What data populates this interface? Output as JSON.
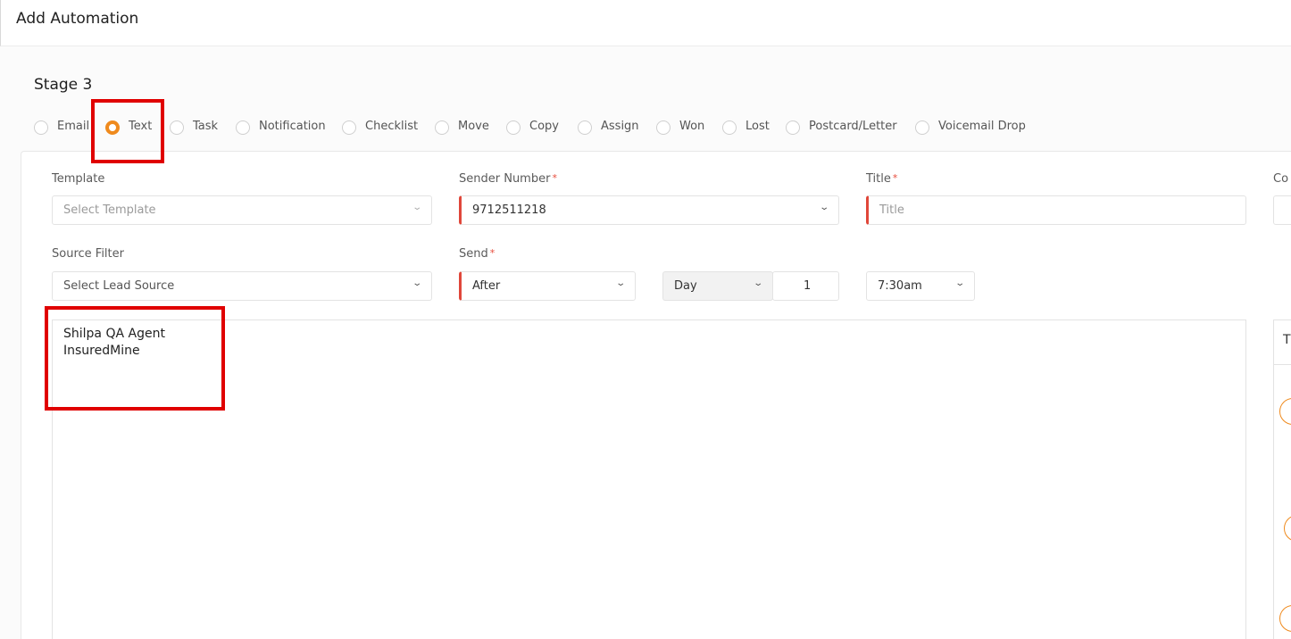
{
  "header": {
    "title": "Add Automation"
  },
  "stage": {
    "title": "Stage 3"
  },
  "action_types": [
    {
      "label": "Email",
      "checked": false
    },
    {
      "label": "Text",
      "checked": true
    },
    {
      "label": "Task",
      "checked": false
    },
    {
      "label": "Notification",
      "checked": false
    },
    {
      "label": "Checklist",
      "checked": false
    },
    {
      "label": "Move",
      "checked": false
    },
    {
      "label": "Copy",
      "checked": false
    },
    {
      "label": "Assign",
      "checked": false
    },
    {
      "label": "Won",
      "checked": false
    },
    {
      "label": "Lost",
      "checked": false
    },
    {
      "label": "Postcard/Letter",
      "checked": false
    },
    {
      "label": "Voicemail Drop",
      "checked": false
    }
  ],
  "form": {
    "template": {
      "label": "Template",
      "placeholder": "Select Template"
    },
    "sender_number": {
      "label": "Sender Number",
      "required_mark": "*",
      "value": "9712511218"
    },
    "title": {
      "label": "Title",
      "required_mark": "*",
      "placeholder": "Title"
    },
    "cut_label": "Co",
    "source_filter": {
      "label": "Source Filter",
      "placeholder": "Select Lead Source"
    },
    "send": {
      "label": "Send",
      "required_mark": "*",
      "timing": "After",
      "unit": "Day",
      "amount": "1",
      "time": "7:30am"
    }
  },
  "editor": {
    "lines": [
      "Shilpa QA Agent",
      "InsuredMine"
    ]
  },
  "side_panel": {
    "header_letter": "T"
  },
  "icons": {
    "chevron": "chevron-down-icon"
  },
  "colors": {
    "accent": "#ef8a1d",
    "required": "#e0473a",
    "highlight": "#e00000"
  }
}
